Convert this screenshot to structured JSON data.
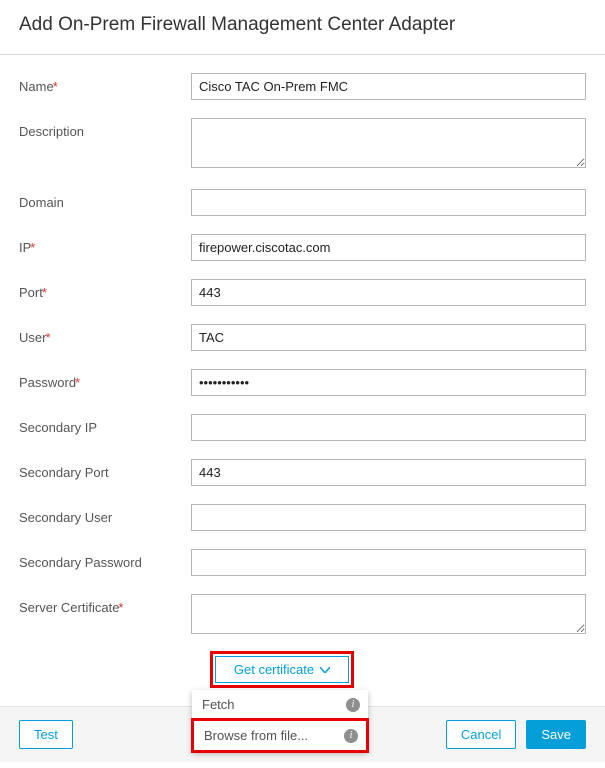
{
  "title": "Add On-Prem Firewall Management Center Adapter",
  "labels": {
    "name": "Name",
    "description": "Description",
    "domain": "Domain",
    "ip": "IP",
    "port": "Port",
    "user": "User",
    "password": "Password",
    "secondary_ip": "Secondary IP",
    "secondary_port": "Secondary Port",
    "secondary_user": "Secondary User",
    "secondary_password": "Secondary Password",
    "server_certificate": "Server Certificate"
  },
  "values": {
    "name": "Cisco TAC On-Prem FMC",
    "description": "",
    "domain": "",
    "ip": "firepower.ciscotac.com",
    "port": "443",
    "user": "TAC",
    "password": "•••••••••••",
    "secondary_ip": "",
    "secondary_port": "443",
    "secondary_user": "",
    "secondary_password": "",
    "server_certificate": ""
  },
  "dropdown": {
    "label": "Get certificate",
    "items": {
      "fetch": "Fetch",
      "browse": "Browse from file..."
    }
  },
  "footer": {
    "test": "Test",
    "cancel": "Cancel",
    "save": "Save"
  }
}
